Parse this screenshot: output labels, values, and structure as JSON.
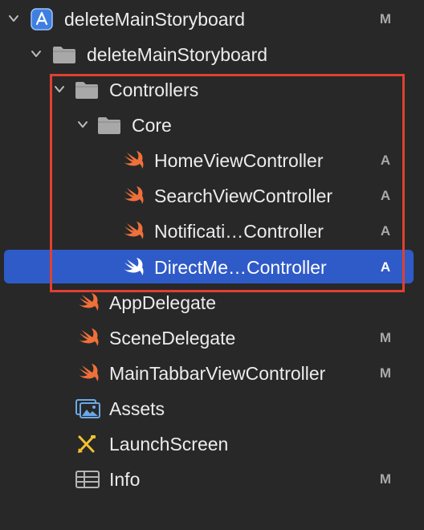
{
  "navigator": {
    "items": [
      {
        "label": "deleteMainStoryboard",
        "status": "M",
        "icon": "xcode-project-icon",
        "expanded": true
      },
      {
        "label": "deleteMainStoryboard",
        "status": "",
        "icon": "folder-icon",
        "expanded": true
      },
      {
        "label": "Controllers",
        "status": "",
        "icon": "folder-icon",
        "expanded": true
      },
      {
        "label": "Core",
        "status": "",
        "icon": "folder-icon",
        "expanded": true
      },
      {
        "label": "HomeViewController",
        "status": "A",
        "icon": "swift-icon"
      },
      {
        "label": "SearchViewController",
        "status": "A",
        "icon": "swift-icon"
      },
      {
        "label": "Notificati…Controller",
        "status": "A",
        "icon": "swift-icon"
      },
      {
        "label": "DirectMe…Controller",
        "status": "A",
        "icon": "swift-icon",
        "selected": true
      },
      {
        "label": "AppDelegate",
        "status": "",
        "icon": "swift-icon"
      },
      {
        "label": "SceneDelegate",
        "status": "M",
        "icon": "swift-icon"
      },
      {
        "label": "MainTabbarViewController",
        "status": "M",
        "icon": "swift-icon"
      },
      {
        "label": "Assets",
        "status": "",
        "icon": "asset-catalog-icon"
      },
      {
        "label": "LaunchScreen",
        "status": "",
        "icon": "storyboard-icon"
      },
      {
        "label": "Info",
        "status": "M",
        "icon": "plist-icon"
      }
    ]
  },
  "colors": {
    "background": "#282828",
    "selection": "#2f5bc8",
    "highlight_border": "#e0402f",
    "swift_orange": "#f0703a",
    "folder_gray": "#a8a8a8",
    "status_gray": "#a9a9a9"
  }
}
